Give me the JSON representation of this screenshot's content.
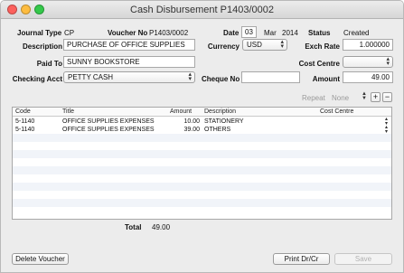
{
  "window": {
    "title": "Cash Disbursement P1403/0002"
  },
  "header": {
    "journal_type_label": "Journal Type",
    "journal_type_value": "CP",
    "voucher_no_label": "Voucher No",
    "voucher_no_value": "P1403/0002",
    "date_label": "Date",
    "date_day": "03",
    "date_month": "Mar",
    "date_year": "2014",
    "status_label": "Status",
    "status_value": "Created",
    "description_label": "Description",
    "description_value": "PURCHASE OF OFFICE SUPPLIES",
    "currency_label": "Currency",
    "currency_value": "USD",
    "exch_rate_label": "Exch Rate",
    "exch_rate_value": "1.000000",
    "paid_to_label": "Paid To",
    "paid_to_value": "SUNNY BOOKSTORE",
    "cost_centre_label": "Cost Centre",
    "cost_centre_value": "",
    "checking_acct_label": "Checking Acct",
    "checking_acct_value": "PETTY CASH",
    "cheque_no_label": "Cheque No",
    "cheque_no_value": "",
    "amount_label": "Amount",
    "amount_value": "49.00"
  },
  "repeat": {
    "label": "Repeat",
    "value": "None",
    "add": "+",
    "remove": "−"
  },
  "table": {
    "columns": [
      "Code",
      "Title",
      "Amount",
      "Description",
      "Cost Centre"
    ],
    "rows": [
      {
        "code": "5-1140",
        "title": "OFFICE SUPPLIES EXPENSES",
        "amount": "10.00",
        "description": "STATIONERY",
        "cost_centre": ""
      },
      {
        "code": "5-1140",
        "title": "OFFICE SUPPLIES EXPENSES",
        "amount": "39.00",
        "description": "OTHERS",
        "cost_centre": ""
      }
    ]
  },
  "totals": {
    "label": "Total",
    "value": "49.00"
  },
  "buttons": {
    "delete": "Delete Voucher",
    "print": "Print Dr/Cr",
    "save": "Save"
  }
}
